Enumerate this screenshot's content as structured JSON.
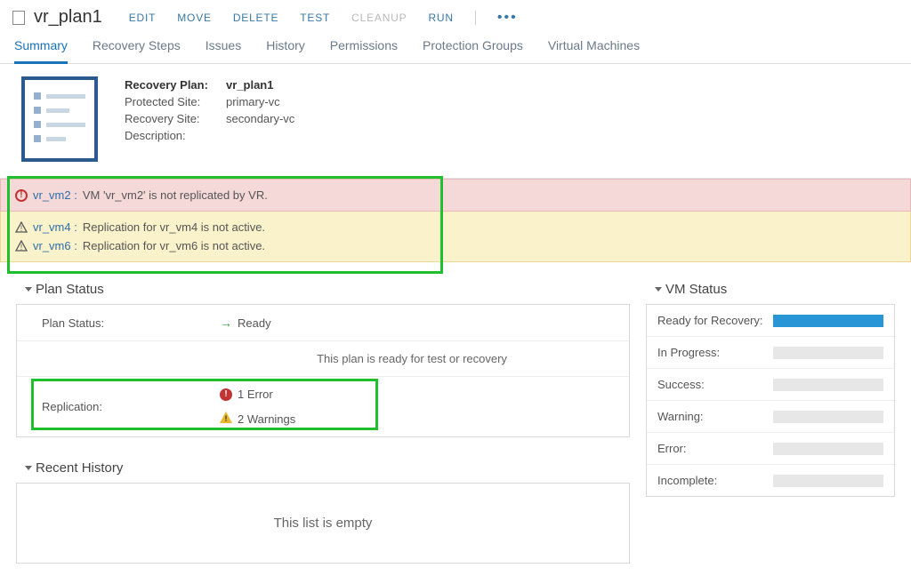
{
  "header": {
    "title": "vr_plan1",
    "actions": [
      "EDIT",
      "MOVE",
      "DELETE",
      "TEST",
      "CLEANUP",
      "RUN"
    ],
    "disabled_actions": [
      "CLEANUP"
    ]
  },
  "tabs": [
    "Summary",
    "Recovery Steps",
    "Issues",
    "History",
    "Permissions",
    "Protection Groups",
    "Virtual Machines"
  ],
  "active_tab": "Summary",
  "plan_info": {
    "label_plan": "Recovery Plan:",
    "plan_name": "vr_plan1",
    "label_protected": "Protected Site:",
    "protected": "primary-vc",
    "label_recovery": "Recovery Site:",
    "recovery": "secondary-vc",
    "label_description": "Description:",
    "description": ""
  },
  "alerts": {
    "error": {
      "vm": "vr_vm2 :",
      "msg": "VM 'vr_vm2' is not replicated by VR."
    },
    "warnings": [
      {
        "vm": "vr_vm4 :",
        "msg": "Replication for vr_vm4 is not active."
      },
      {
        "vm": "vr_vm6 :",
        "msg": "Replication for vr_vm6 is not active."
      }
    ]
  },
  "plan_status": {
    "title": "Plan Status",
    "label_status": "Plan Status:",
    "status": "Ready",
    "ready_msg": "This plan is ready for test or recovery",
    "label_replication": "Replication:",
    "errors": "1 Error",
    "warnings": "2 Warnings"
  },
  "recent_history": {
    "title": "Recent History",
    "empty": "This list is empty"
  },
  "vm_status": {
    "title": "VM Status",
    "rows": [
      {
        "label": "Ready for Recovery:",
        "fill": true
      },
      {
        "label": "In Progress:",
        "fill": false
      },
      {
        "label": "Success:",
        "fill": false
      },
      {
        "label": "Warning:",
        "fill": false
      },
      {
        "label": "Error:",
        "fill": false
      },
      {
        "label": "Incomplete:",
        "fill": false
      }
    ]
  }
}
